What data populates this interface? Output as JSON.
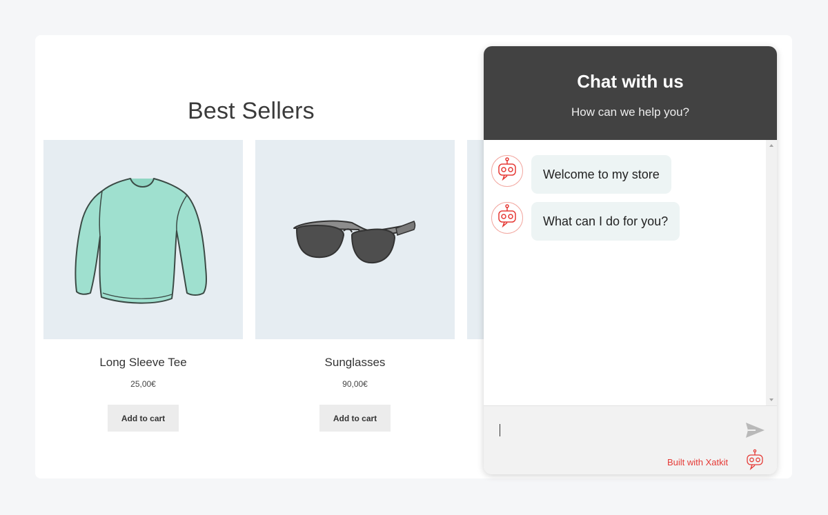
{
  "shop": {
    "section_title": "Best Sellers",
    "products": [
      {
        "name": "Long Sleeve Tee",
        "price": "25,00€",
        "button": "Add to cart",
        "icon": "long-sleeve-tee-image"
      },
      {
        "name": "Sunglasses",
        "price": "90,00€",
        "button": "Add to cart",
        "icon": "sunglasses-image"
      }
    ]
  },
  "chat": {
    "title": "Chat with us",
    "subtitle": "How can we help you?",
    "messages": [
      {
        "sender": "bot",
        "text": "Welcome to my store"
      },
      {
        "sender": "bot",
        "text": "What can I do for you?"
      }
    ],
    "input_value": "",
    "branding": "Built with Xatkit",
    "colors": {
      "header": "#424242",
      "bubble": "#edf4f4",
      "brand": "#e53935",
      "accent": "#f2a7a0"
    }
  }
}
